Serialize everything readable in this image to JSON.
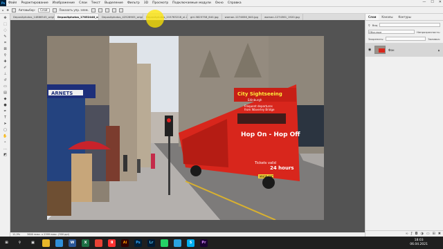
{
  "menu": {
    "logo": "Ps",
    "items": [
      "Файл",
      "Редактирование",
      "Изображение",
      "Слои",
      "Текст",
      "Выделение",
      "Фильтр",
      "3D",
      "Просмотр",
      "Подключаемые модули",
      "Окно",
      "Справка"
    ]
  },
  "options": {
    "autoselect_label": "Автовыбор:",
    "autoselect_value": "Слой",
    "show_transform_label": "Показать упр. элем."
  },
  "tabs": [
    "Depositphotos_14866545_original.jpg",
    "Depositphotos_17852448_original.jpg @ 12,5% (RGB/8)",
    "Depositphotos_42526905_original.jpg",
    "Depositphotos_215763218_xl-2015.jpg",
    "girl-5825758_640.jpg",
    "woman-1274656_640.jpg",
    "woman-1274361_1920.jpg"
  ],
  "status": {
    "zoom": "12,5%",
    "doc_size": "3600 пикс. x 2399 пикс. (300 ppi)"
  },
  "photo": {
    "sign_top": "City Sightseeing",
    "sign_sub": "Edinburgh",
    "tag1": "Frequent departures",
    "tag2": "from Waverley Bridge",
    "hop_on": "Hop On - Hop Off",
    "tickets": "Tickets valid",
    "hours": "24 hours",
    "shop": "ARNETS",
    "plate": "MX09 EYC"
  },
  "panel": {
    "tabs": [
      "Слои",
      "Каналы",
      "Контуры"
    ],
    "search_label": "Вид",
    "blend_mode": "Обычные",
    "opacity_label": "Непрозрачность:",
    "lock_label": "Закрепить:",
    "fill_label": "Заливка:",
    "layer_name": "Фон"
  },
  "taskbar": {
    "time": "18:03",
    "date": "06.04.2021"
  },
  "colors": {
    "bus_red": "#d8261c",
    "ps_blue": "#31a8ff",
    "ps_dark": "#001e36",
    "highlight": "#ffe600"
  }
}
